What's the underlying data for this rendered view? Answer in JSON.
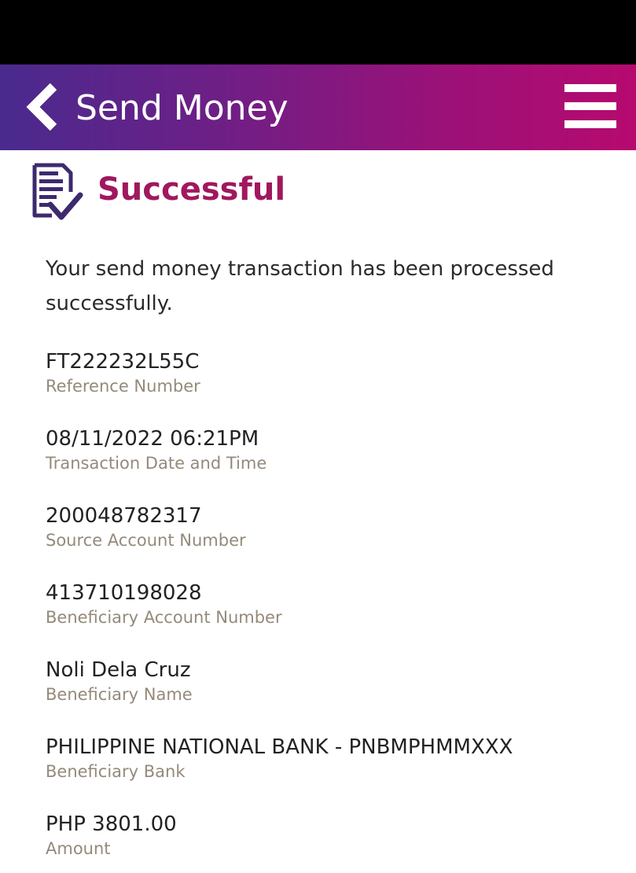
{
  "header": {
    "title": "Send Money",
    "back_icon": "chevron-left-icon",
    "menu_icon": "hamburger-menu-icon"
  },
  "status": {
    "icon": "receipt-check-icon",
    "title": "Successful"
  },
  "message": "Your send money transaction has been processed successfully.",
  "details": [
    {
      "value": "FT222232L55C",
      "label": "Reference Number"
    },
    {
      "value": "08/11/2022 06:21PM",
      "label": "Transaction Date and Time"
    },
    {
      "value": "200048782317",
      "label": "Source Account Number"
    },
    {
      "value": "413710198028",
      "label": "Beneficiary Account Number"
    },
    {
      "value": "Noli Dela Cruz",
      "label": "Beneficiary Name"
    },
    {
      "value": "PHILIPPINE NATIONAL BANK - PNBMPHMMXXX",
      "label": "Beneficiary Bank"
    },
    {
      "value": "PHP 3801.00",
      "label": "Amount"
    }
  ],
  "colors": {
    "header_gradient_start": "#4a2a8e",
    "header_gradient_end": "#b60a6f",
    "status_title": "#a0185e",
    "icon": "#3d2a6e",
    "label": "#948a7a"
  }
}
